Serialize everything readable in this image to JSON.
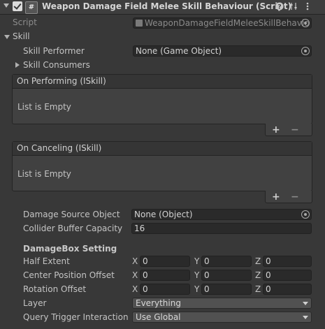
{
  "component": {
    "title": "Weapon Damage Field Melee Skill Behaviour (Script)",
    "header_icons": [
      "help-icon",
      "settings-icon",
      "more-icon"
    ]
  },
  "script": {
    "label": "Script",
    "value": "WeaponDamageFieldMeleeSkillBehavio"
  },
  "skill": {
    "label": "Skill",
    "performer": {
      "label": "Skill Performer",
      "value": "None (Game Object)"
    },
    "consumers": {
      "label": "Skill Consumers"
    },
    "on_performing": {
      "title": "On Performing (ISkill)",
      "empty": "List is Empty",
      "add": "+",
      "remove": "−"
    },
    "on_canceling": {
      "title": "On Canceling (ISkill)",
      "empty": "List is Empty",
      "add": "+",
      "remove": "−"
    }
  },
  "damage_source": {
    "label": "Damage Source Object",
    "value": "None (Object)"
  },
  "collider_buffer": {
    "label": "Collider Buffer Capacity",
    "value": "16"
  },
  "damagebox": {
    "heading": "DamageBox Setting",
    "axes": {
      "x": "X",
      "y": "Y",
      "z": "Z"
    },
    "half_extent": {
      "label": "Half Extent",
      "x": "0",
      "y": "0",
      "z": "0"
    },
    "center_offset": {
      "label": "Center Position Offset",
      "x": "0",
      "y": "0",
      "z": "0"
    },
    "rotation_offset": {
      "label": "Rotation Offset",
      "x": "0",
      "y": "0",
      "z": "0"
    }
  },
  "layer": {
    "label": "Layer",
    "value": "Everything"
  },
  "query_trigger": {
    "label": "Query Trigger Interaction",
    "value": "Use Global"
  }
}
